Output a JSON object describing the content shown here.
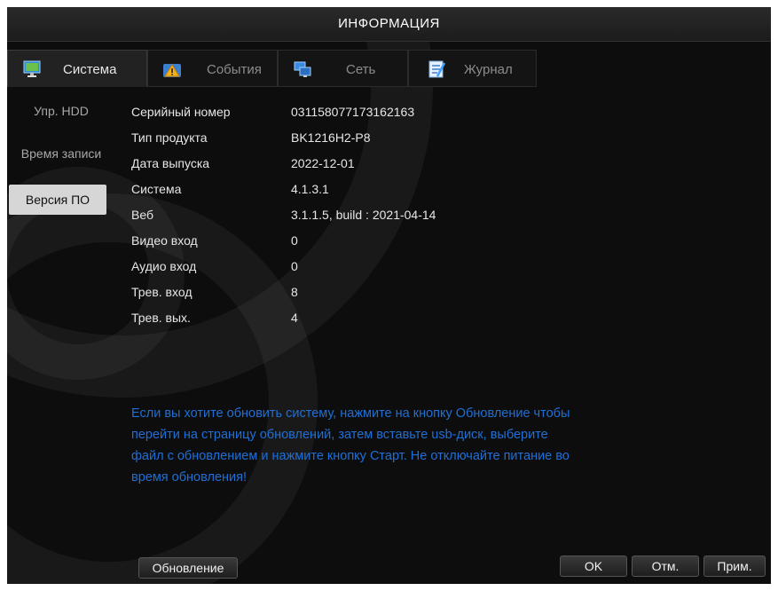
{
  "window": {
    "title": "ИНФОРМАЦИЯ"
  },
  "tabs": [
    {
      "label": "Система",
      "icon": "monitor-icon",
      "active": true
    },
    {
      "label": "События",
      "icon": "warning-icon",
      "active": false
    },
    {
      "label": "Сеть",
      "icon": "network-icon",
      "active": false
    },
    {
      "label": "Журнал",
      "icon": "log-icon",
      "active": false
    }
  ],
  "sidebar": {
    "items": [
      {
        "label": "Упр. HDD"
      },
      {
        "label": "Время записи"
      },
      {
        "label": "Версия ПО",
        "active": true
      }
    ]
  },
  "info": {
    "rows": [
      {
        "label": "Серийный номер",
        "value": "031158077173162163"
      },
      {
        "label": "Тип продукта",
        "value": "BK1216H2-P8"
      },
      {
        "label": "Дата выпуска",
        "value": "2022-12-01"
      },
      {
        "label": "Система",
        "value": "4.1.3.1"
      },
      {
        "label": "Веб",
        "value": "3.1.1.5, build : 2021-04-14"
      },
      {
        "label": "Видео вход",
        "value": "0"
      },
      {
        "label": "Аудио вход",
        "value": "0"
      },
      {
        "label": "Трев. вход",
        "value": "8"
      },
      {
        "label": "Трев. вых.",
        "value": "4"
      }
    ]
  },
  "note": {
    "lines": [
      "Если вы хотите обновить систему, нажмите на кнопку Обновление чтобы",
      "перейти на страницу обновлений, затем вставьте usb-диск, выберите",
      "файл с обновлением и нажмите кнопку Старт. Не отключайте питание во",
      "время обновления!"
    ]
  },
  "buttons": {
    "update": "Обновление",
    "ok": "OK",
    "cancel": "Отм.",
    "apply": "Прим."
  },
  "colors": {
    "background": "#0d0d0d",
    "note_text": "#1f6fd6",
    "active_side": "#d6d6d6"
  }
}
